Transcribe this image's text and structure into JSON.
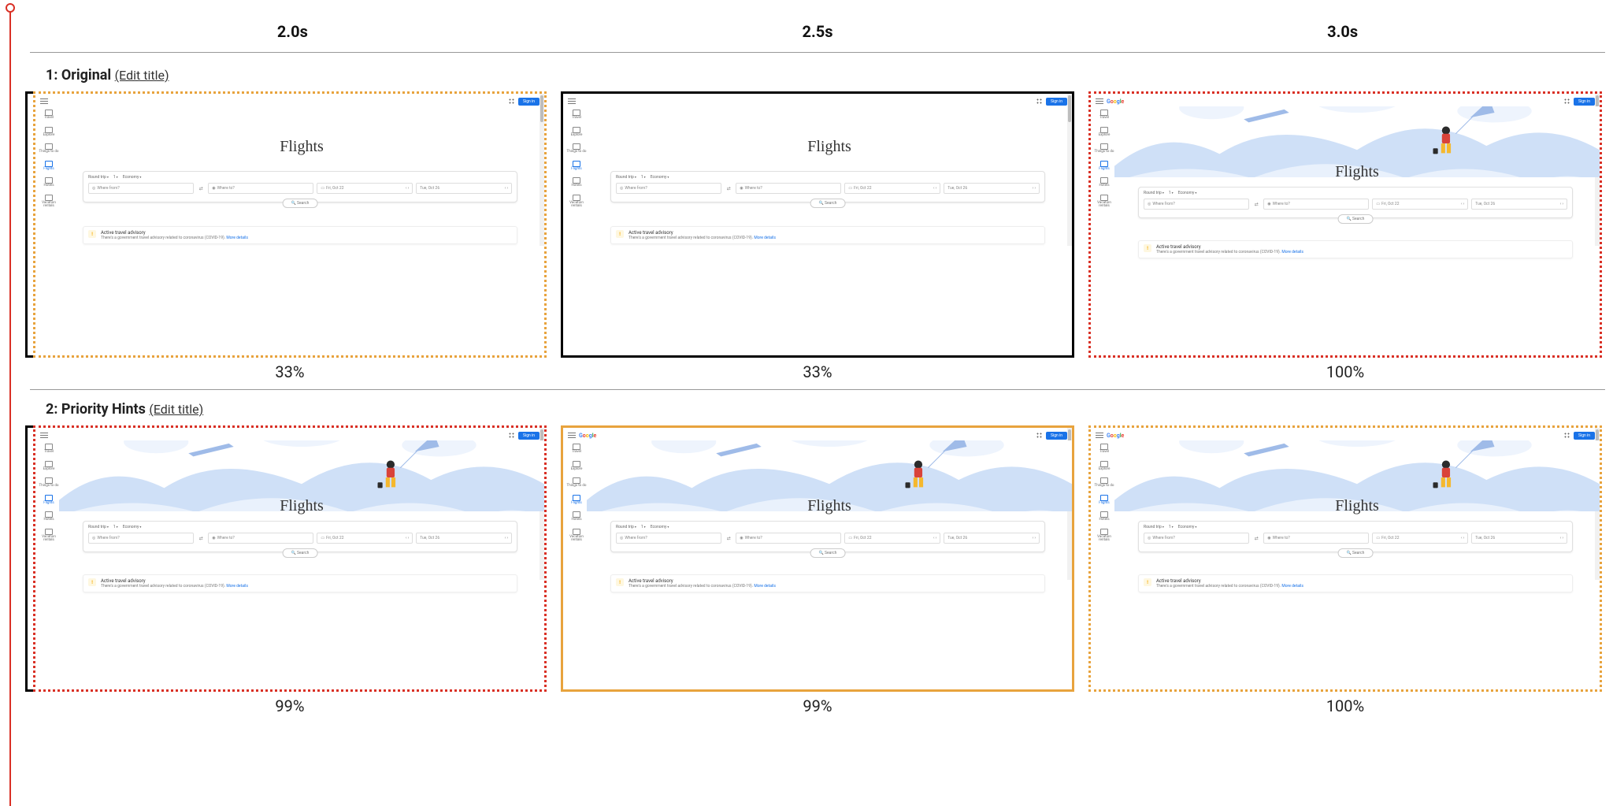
{
  "timestamps": [
    "2.0s",
    "2.5s",
    "3.0s"
  ],
  "rows": [
    {
      "index": "1",
      "title": "Original",
      "edit": "(Edit title)",
      "cells": [
        {
          "border": "dot-orange",
          "pct": "33%",
          "hero": false,
          "logo": false
        },
        {
          "border": "solid-black",
          "pct": "33%",
          "hero": false,
          "logo": false
        },
        {
          "border": "dot-red",
          "pct": "100%",
          "hero": true,
          "logo": true
        }
      ]
    },
    {
      "index": "2",
      "title": "Priority Hints",
      "edit": "(Edit title)",
      "cells": [
        {
          "border": "dot-red",
          "pct": "99%",
          "hero": true,
          "logo": false
        },
        {
          "border": "solid-orange",
          "pct": "99%",
          "hero": true,
          "logo": true
        },
        {
          "border": "dot-orange",
          "pct": "100%",
          "hero": true,
          "logo": true
        }
      ]
    }
  ],
  "mock": {
    "signin": "Sign in",
    "title": "Flights",
    "sidebar": [
      "Travel",
      "Explore",
      "Things to do",
      "Flights",
      "Hotels",
      "Vacation rentals"
    ],
    "sidebar_active_index": 3,
    "chips": [
      "Round trip",
      "1",
      "Economy"
    ],
    "where_from": "Where from?",
    "where_to": "Where to?",
    "date1": "Fri, Oct 22",
    "date2": "Tue, Oct 26",
    "search": "Search",
    "advisory_title": "Active travel advisory",
    "advisory_sub_prefix": "There's a government travel advisory related to coronavirus (COVID-19). ",
    "advisory_link": "More details"
  }
}
